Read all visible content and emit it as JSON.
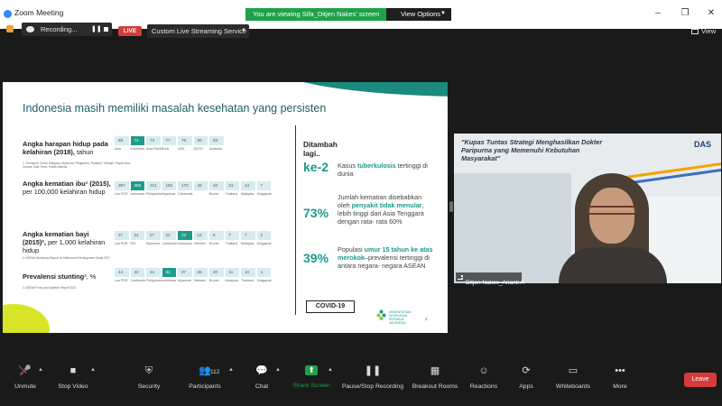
{
  "window": {
    "title": "Zoom Meeting",
    "viewing_banner": "You are viewing Sifa_Ditjen Nakes' screen",
    "view_options": "View Options",
    "minimize_glyph": "–",
    "restore_glyph": "❐",
    "close_glyph": "✕"
  },
  "topbar": {
    "recording_label": "Recording...",
    "live_badge": "LIVE",
    "stream_service": "Custom Live Streaming Service",
    "view_label": "View"
  },
  "slide": {
    "title": "Indonesia masih memiliki masalah kesehatan yang persisten",
    "metrics": [
      {
        "label_bold": "Angka harapan  hidup pada kelahiran (2018),",
        "label_normal": " tahun",
        "note": "1. Termasuk: China, Malaysia, Myanmar, Philippines, Thailand, Vietnam, Papua New Guinea, East Timor, Pacific Islands",
        "values": [
          "69",
          "71",
          "73",
          "77",
          "79",
          "80",
          "83"
        ],
        "categories": [
          "Asia",
          "Indonesia",
          "Asia Pacific",
          "Turki",
          "USA",
          "OECD",
          "Australia"
        ]
      },
      {
        "label_bold": "Angka kematian ibu¹ (2015),",
        "label_normal": " per 100,000 kelahiran  hidup",
        "note": "",
        "values": [
          "397",
          "305",
          "221",
          "182",
          "170",
          "45",
          "40",
          "21",
          "14",
          "7"
        ],
        "categories": [
          "Lao PDR",
          "Indonesia",
          "Philippines",
          "Myanmar",
          "Cambodia",
          "",
          "Brunei",
          "Thailand",
          "Malaysia",
          "Singapore"
        ]
      },
      {
        "label_bold": "Angka kematian bayi (2015)²,",
        "label_normal": " per 1,000 kelahiran hidup",
        "note": "2. ASEAN Workshop Report on Millennium Development Goals 2017",
        "values": [
          "37",
          "24",
          "27",
          "22",
          "23",
          "13",
          "8",
          "7",
          "7",
          "2"
        ],
        "categories": [
          "Lao PDR",
          "RKI",
          "Myanmar",
          "Cambodia",
          "Indonesia",
          "Vietnam",
          "Brunei",
          "Thailand",
          "Malaysia",
          "Singapore"
        ]
      },
      {
        "label_bold": "Prevalensi  stunting",
        "label_normal": "³, %",
        "note": "3. ASEAN Food and Nutrition Report 2021",
        "values": [
          "44",
          "32",
          "34",
          "31",
          "27",
          "28",
          "20",
          "11",
          "10",
          "4"
        ],
        "categories": [
          "Lao PDR",
          "Cambodia",
          "Philippines",
          "Indonesia",
          "Myanmar",
          "Vietnam",
          "Brunei",
          "Malaysia",
          "Thailand",
          "Singapore"
        ]
      }
    ],
    "side": {
      "heading": "Ditambah lagi..",
      "stats": [
        {
          "big": "ke-2",
          "text_pre": "Kasus ",
          "text_accent": "tuberkulosis",
          "text_post": " tertinggi di dunia"
        },
        {
          "big": "73%",
          "text_pre": "Jumlah kematian disebabkan oleh ",
          "text_accent": "penyakit tidak  menular",
          "text_post": ", lebih tinggi dari  Asia Tenggara dengan rata- rata 60%"
        },
        {
          "big": "39%",
          "text_pre": "Populasi ",
          "text_accent": "umur 15 tahun ke atas merokok",
          "text_post": "–prevalensi tertinggi di antara negara-  negara ASEAN"
        }
      ],
      "covid_label": "COVID-19",
      "org_name": "KEMENTERIAN KESEHATAN REPUBLIK INDONESIA",
      "page_number": "2"
    }
  },
  "video": {
    "banner_title": "\"Kupas Tuntas Strategi Menghasilkan Dokter Paripurna yang Memenuhi Kebutuhan Masyarakat\"",
    "logo_text": "DAS",
    "participant_name": "Ditjen Nakes_Arianti A"
  },
  "toolbar": {
    "items": [
      {
        "label": "Unmute",
        "icon": "🎤"
      },
      {
        "label": "Stop Video",
        "icon": "■"
      },
      {
        "label": "Security",
        "icon": "⛨"
      },
      {
        "label": "Participants",
        "icon": "👥"
      },
      {
        "label": "Chat",
        "icon": "💬"
      },
      {
        "label": "Share Screen",
        "icon": "⬆"
      },
      {
        "label": "Pause/Stop Recording",
        "icon": "❚❚"
      },
      {
        "label": "Breakout Rooms",
        "icon": "▦"
      },
      {
        "label": "Reactions",
        "icon": "☺"
      },
      {
        "label": "Apps",
        "icon": "⟳"
      },
      {
        "label": "Whiteboards",
        "icon": "▭"
      },
      {
        "label": "More",
        "icon": "•••"
      }
    ],
    "participants_count": "112",
    "leave_label": "Leave"
  },
  "colors": {
    "accent_green": "#1ea14a",
    "leave_red": "#d63b3b",
    "slide_teal": "#1c9b8a",
    "slide_title": "#1c5e65"
  }
}
